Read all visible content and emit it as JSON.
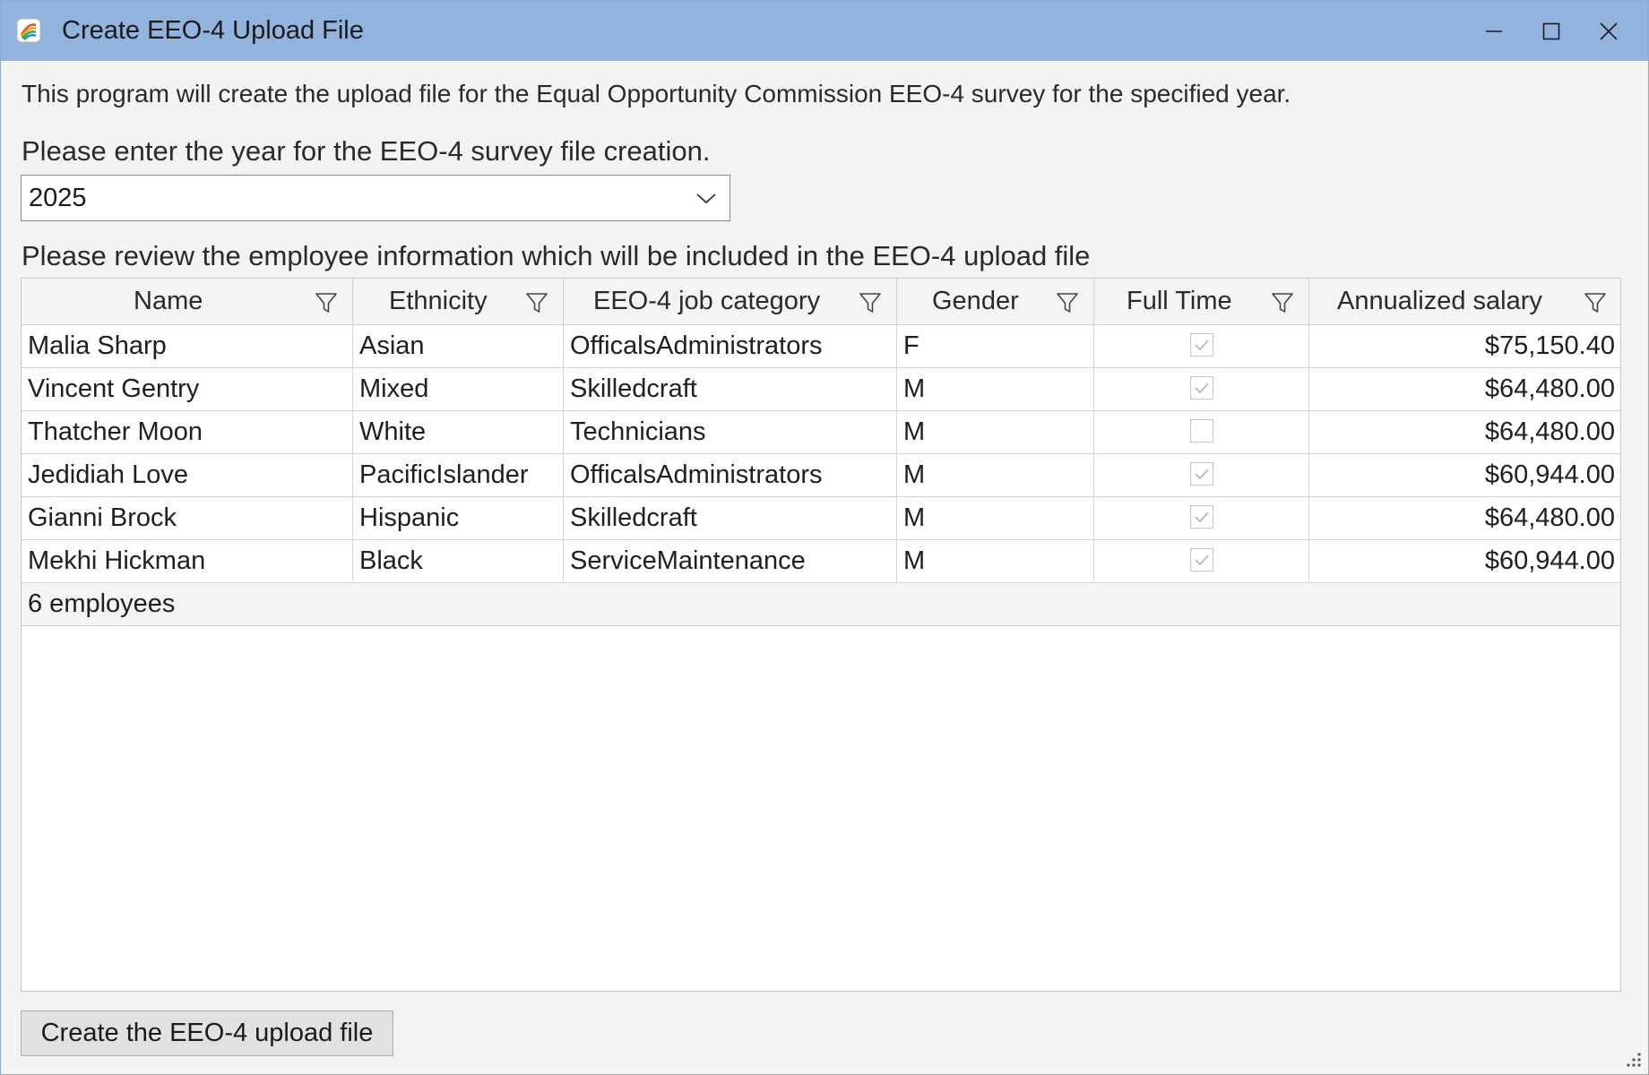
{
  "window": {
    "title": "Create EEO-4 Upload File",
    "minimize_icon": "minimize-icon",
    "maximize_icon": "maximize-icon",
    "close_icon": "close-icon"
  },
  "intro_text": "This program will create the upload file for the Equal Opportunity Commission EEO-4 survey for the specified year.",
  "year": {
    "label": "Please enter the year for the EEO-4 survey file creation.",
    "value": "2025"
  },
  "review_label": "Please review the employee information which will be included in the EEO-4 upload file",
  "grid": {
    "columns": [
      {
        "label": "Name"
      },
      {
        "label": "Ethnicity"
      },
      {
        "label": "EEO-4 job category"
      },
      {
        "label": "Gender"
      },
      {
        "label": "Full Time"
      },
      {
        "label": "Annualized salary"
      }
    ],
    "rows": [
      {
        "name": "Malia Sharp",
        "ethnicity": "Asian",
        "category": "OfficalsAdministrators",
        "gender": "F",
        "full_time": true,
        "salary": "$75,150.40"
      },
      {
        "name": "Vincent Gentry",
        "ethnicity": "Mixed",
        "category": "Skilledcraft",
        "gender": "M",
        "full_time": true,
        "salary": "$64,480.00"
      },
      {
        "name": "Thatcher Moon",
        "ethnicity": "White",
        "category": "Technicians",
        "gender": "M",
        "full_time": false,
        "salary": "$64,480.00"
      },
      {
        "name": "Jedidiah Love",
        "ethnicity": "PacificIslander",
        "category": "OfficalsAdministrators",
        "gender": "M",
        "full_time": true,
        "salary": "$60,944.00"
      },
      {
        "name": "Gianni Brock",
        "ethnicity": "Hispanic",
        "category": "Skilledcraft",
        "gender": "M",
        "full_time": true,
        "salary": "$64,480.00"
      },
      {
        "name": "Mekhi Hickman",
        "ethnicity": "Black",
        "category": "ServiceMaintenance",
        "gender": "M",
        "full_time": true,
        "salary": "$60,944.00"
      }
    ],
    "footer": "6 employees"
  },
  "create_button_label": "Create the EEO-4 upload file",
  "colors": {
    "titlebar": "#93b3df",
    "background": "#f3f3f3"
  }
}
